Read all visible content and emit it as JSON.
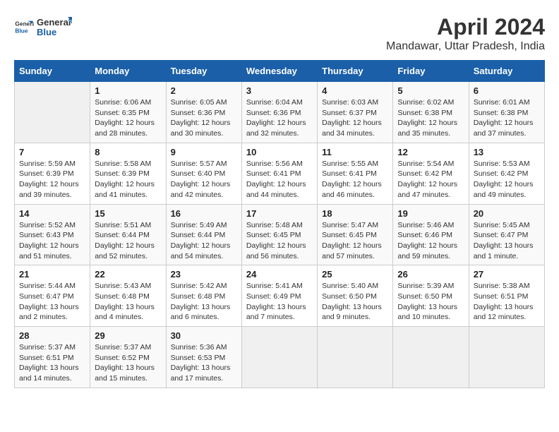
{
  "header": {
    "logo_general": "General",
    "logo_blue": "Blue",
    "title": "April 2024",
    "subtitle": "Mandawar, Uttar Pradesh, India"
  },
  "days_of_week": [
    "Sunday",
    "Monday",
    "Tuesday",
    "Wednesday",
    "Thursday",
    "Friday",
    "Saturday"
  ],
  "weeks": [
    [
      {
        "day": "",
        "info": ""
      },
      {
        "day": "1",
        "info": "Sunrise: 6:06 AM\nSunset: 6:35 PM\nDaylight: 12 hours\nand 28 minutes."
      },
      {
        "day": "2",
        "info": "Sunrise: 6:05 AM\nSunset: 6:36 PM\nDaylight: 12 hours\nand 30 minutes."
      },
      {
        "day": "3",
        "info": "Sunrise: 6:04 AM\nSunset: 6:36 PM\nDaylight: 12 hours\nand 32 minutes."
      },
      {
        "day": "4",
        "info": "Sunrise: 6:03 AM\nSunset: 6:37 PM\nDaylight: 12 hours\nand 34 minutes."
      },
      {
        "day": "5",
        "info": "Sunrise: 6:02 AM\nSunset: 6:38 PM\nDaylight: 12 hours\nand 35 minutes."
      },
      {
        "day": "6",
        "info": "Sunrise: 6:01 AM\nSunset: 6:38 PM\nDaylight: 12 hours\nand 37 minutes."
      }
    ],
    [
      {
        "day": "7",
        "info": "Sunrise: 5:59 AM\nSunset: 6:39 PM\nDaylight: 12 hours\nand 39 minutes."
      },
      {
        "day": "8",
        "info": "Sunrise: 5:58 AM\nSunset: 6:39 PM\nDaylight: 12 hours\nand 41 minutes."
      },
      {
        "day": "9",
        "info": "Sunrise: 5:57 AM\nSunset: 6:40 PM\nDaylight: 12 hours\nand 42 minutes."
      },
      {
        "day": "10",
        "info": "Sunrise: 5:56 AM\nSunset: 6:41 PM\nDaylight: 12 hours\nand 44 minutes."
      },
      {
        "day": "11",
        "info": "Sunrise: 5:55 AM\nSunset: 6:41 PM\nDaylight: 12 hours\nand 46 minutes."
      },
      {
        "day": "12",
        "info": "Sunrise: 5:54 AM\nSunset: 6:42 PM\nDaylight: 12 hours\nand 47 minutes."
      },
      {
        "day": "13",
        "info": "Sunrise: 5:53 AM\nSunset: 6:42 PM\nDaylight: 12 hours\nand 49 minutes."
      }
    ],
    [
      {
        "day": "14",
        "info": "Sunrise: 5:52 AM\nSunset: 6:43 PM\nDaylight: 12 hours\nand 51 minutes."
      },
      {
        "day": "15",
        "info": "Sunrise: 5:51 AM\nSunset: 6:44 PM\nDaylight: 12 hours\nand 52 minutes."
      },
      {
        "day": "16",
        "info": "Sunrise: 5:49 AM\nSunset: 6:44 PM\nDaylight: 12 hours\nand 54 minutes."
      },
      {
        "day": "17",
        "info": "Sunrise: 5:48 AM\nSunset: 6:45 PM\nDaylight: 12 hours\nand 56 minutes."
      },
      {
        "day": "18",
        "info": "Sunrise: 5:47 AM\nSunset: 6:45 PM\nDaylight: 12 hours\nand 57 minutes."
      },
      {
        "day": "19",
        "info": "Sunrise: 5:46 AM\nSunset: 6:46 PM\nDaylight: 12 hours\nand 59 minutes."
      },
      {
        "day": "20",
        "info": "Sunrise: 5:45 AM\nSunset: 6:47 PM\nDaylight: 13 hours\nand 1 minute."
      }
    ],
    [
      {
        "day": "21",
        "info": "Sunrise: 5:44 AM\nSunset: 6:47 PM\nDaylight: 13 hours\nand 2 minutes."
      },
      {
        "day": "22",
        "info": "Sunrise: 5:43 AM\nSunset: 6:48 PM\nDaylight: 13 hours\nand 4 minutes."
      },
      {
        "day": "23",
        "info": "Sunrise: 5:42 AM\nSunset: 6:48 PM\nDaylight: 13 hours\nand 6 minutes."
      },
      {
        "day": "24",
        "info": "Sunrise: 5:41 AM\nSunset: 6:49 PM\nDaylight: 13 hours\nand 7 minutes."
      },
      {
        "day": "25",
        "info": "Sunrise: 5:40 AM\nSunset: 6:50 PM\nDaylight: 13 hours\nand 9 minutes."
      },
      {
        "day": "26",
        "info": "Sunrise: 5:39 AM\nSunset: 6:50 PM\nDaylight: 13 hours\nand 10 minutes."
      },
      {
        "day": "27",
        "info": "Sunrise: 5:38 AM\nSunset: 6:51 PM\nDaylight: 13 hours\nand 12 minutes."
      }
    ],
    [
      {
        "day": "28",
        "info": "Sunrise: 5:37 AM\nSunset: 6:51 PM\nDaylight: 13 hours\nand 14 minutes."
      },
      {
        "day": "29",
        "info": "Sunrise: 5:37 AM\nSunset: 6:52 PM\nDaylight: 13 hours\nand 15 minutes."
      },
      {
        "day": "30",
        "info": "Sunrise: 5:36 AM\nSunset: 6:53 PM\nDaylight: 13 hours\nand 17 minutes."
      },
      {
        "day": "",
        "info": ""
      },
      {
        "day": "",
        "info": ""
      },
      {
        "day": "",
        "info": ""
      },
      {
        "day": "",
        "info": ""
      }
    ]
  ]
}
